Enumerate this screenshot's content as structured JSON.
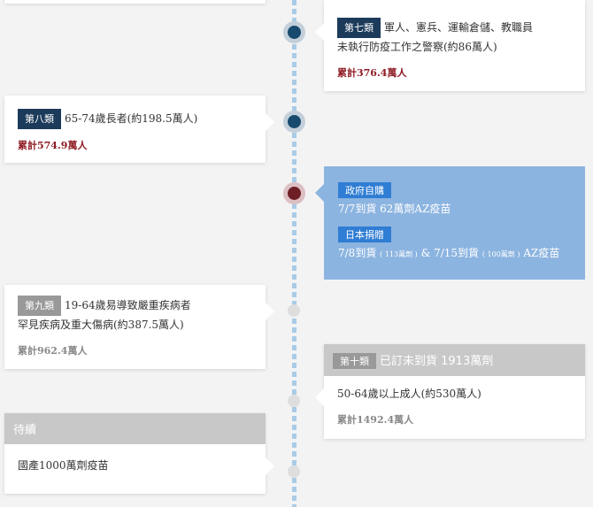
{
  "top_card": {
    "tag": "第七類",
    "line1": "軍人、憲兵、運輸倉儲、教職員",
    "line2": "未執行防疫工作之警察(約86萬人)",
    "cumulative": "累計376.4萬人"
  },
  "card8": {
    "tag": "第八類",
    "line1": "65-74歲長者(約198.5萬人)",
    "cumulative": "累計574.9萬人"
  },
  "blue_card": {
    "tag1": "政府自購",
    "line1": "7/7到貨 62萬劑AZ疫苗",
    "tag2": "日本捐贈",
    "line2_a": "7/8到貨",
    "line2_a_small": "( 113萬劑 )",
    "line2_b": "& 7/15到貨",
    "line2_b_small": "( 100萬劑 )",
    "line2_c": "AZ疫苗"
  },
  "card9": {
    "tag": "第九類",
    "line1": "19-64歲易導致嚴重疾病者",
    "line2": "罕見疾病及重大傷病(約387.5萬人)",
    "cumulative": "累計962.4萬人"
  },
  "card10": {
    "tag": "第十類",
    "header_text": "已訂未到貨 1913萬劑",
    "line1": "50-64歲以上成人(約530萬人)",
    "cumulative": "累計1492.4萬人"
  },
  "pending_card": {
    "header": "待續",
    "line1": "國產1000萬劑疫苗"
  },
  "colors": {
    "navy": "#1c3b5a",
    "dark_red": "#8e1b23",
    "blue_panel": "#8cb4e0",
    "spine": "#a9cbe6"
  }
}
